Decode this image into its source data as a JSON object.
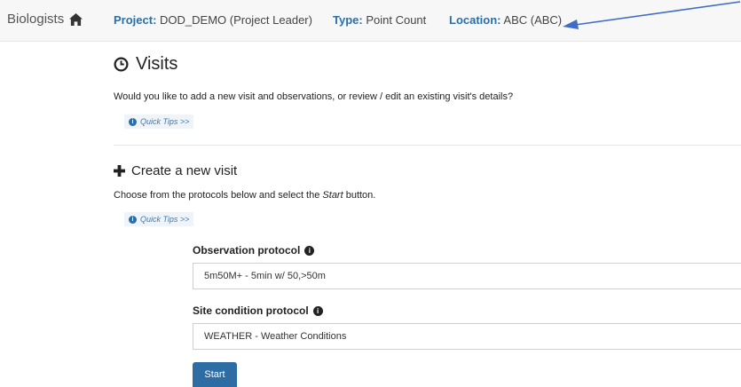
{
  "nav": {
    "brand": "Biologists",
    "project_key": "Project:",
    "project_value": " DOD_DEMO (Project Leader)",
    "type_key": "Type:",
    "type_value": " Point Count",
    "location_key": "Location:",
    "location_value": " ABC (ABC)"
  },
  "visits": {
    "title": "Visits",
    "description": "Would you like to add a new visit and observations, or review / edit an existing visit's details?",
    "quick_tips": "Quick Tips >>"
  },
  "create": {
    "title": "Create a new visit",
    "desc_before": "Choose from the protocols below and select the ",
    "desc_em": "Start",
    "desc_after": " button.",
    "quick_tips": "Quick Tips >>"
  },
  "form": {
    "observation_label": "Observation protocol",
    "observation_value": "5m50M+ - 5min w/ 50,>50m",
    "site_label": "Site condition protocol",
    "site_value": "WEATHER - Weather Conditions",
    "start_label": "Start"
  },
  "colors": {
    "accent": "#2a6fa8",
    "button": "#2e6da4",
    "annotation_arrow": "#3f6cc4"
  }
}
